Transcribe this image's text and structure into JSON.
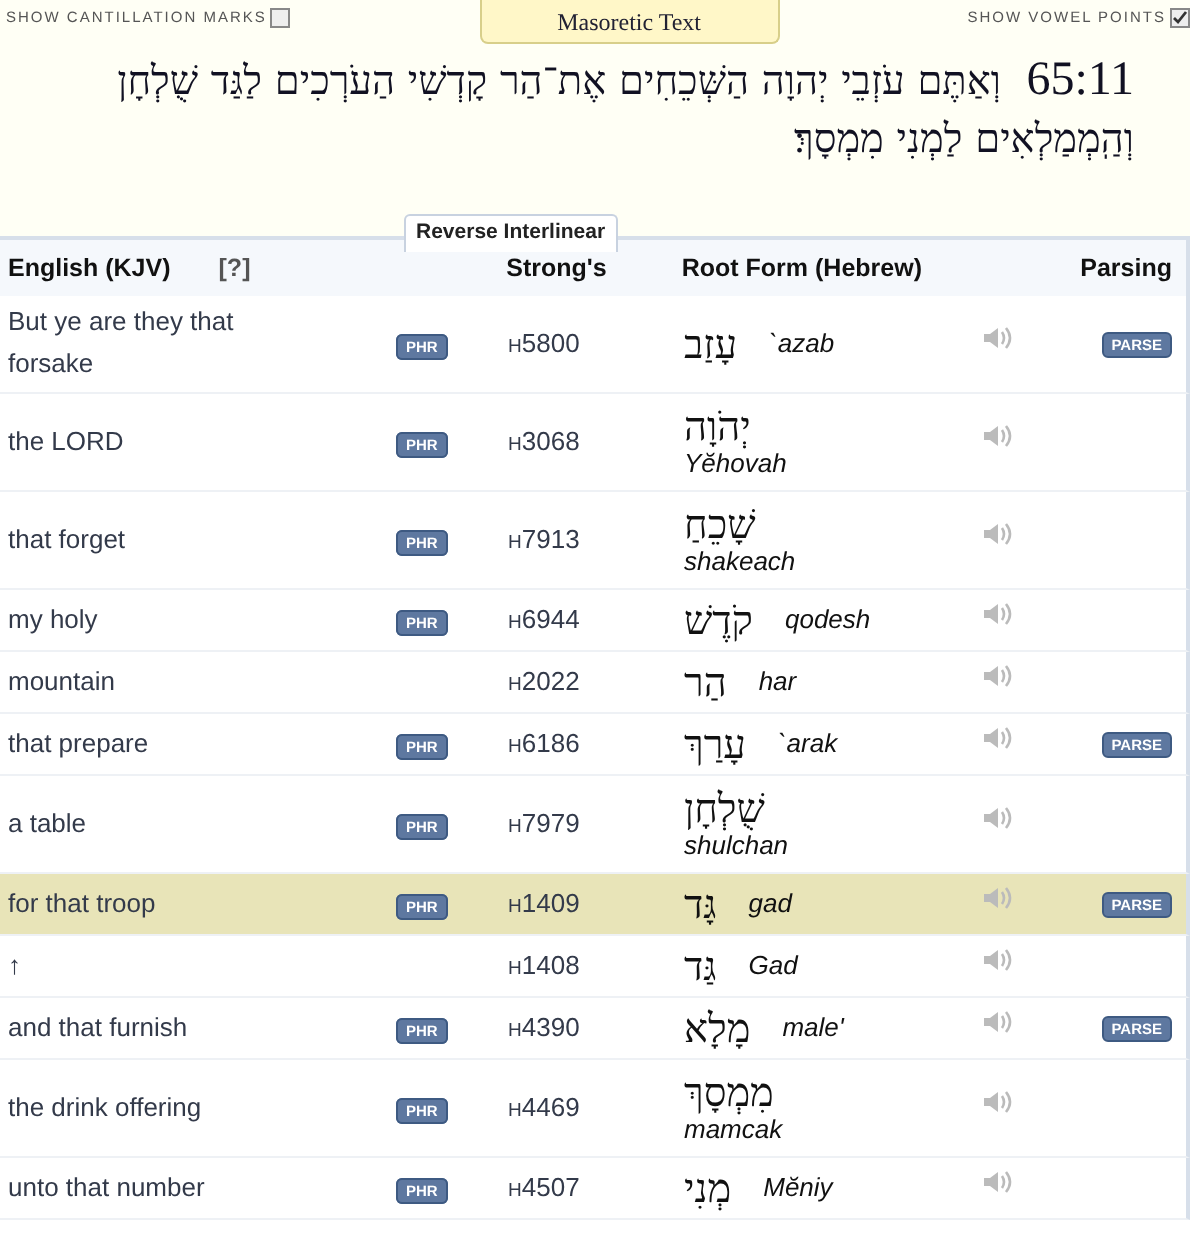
{
  "options": [
    {
      "label": "SHOW CANTILLATION MARKS",
      "checked": false
    },
    {
      "label": "SHOW VOWEL POINTS",
      "checked": true
    }
  ],
  "top_tab": {
    "label": "Masoretic Text"
  },
  "verse": {
    "reference": "65:11",
    "text": "וְאַתֶּם עֹזְבֵי יְהוָה הַשְּׁכֵחִים אֶת־הַר קָדְשִׁי הַעֹרְכִים לַגַּד שֻׁלְחָן וְהַֽמְמַלְאִים לַמְנִי מִמְסָךְ׃"
  },
  "section_tab": {
    "label": "Reverse Interlinear"
  },
  "table": {
    "columns": [
      {
        "label": "English (KJV)",
        "help": "[?]"
      },
      {
        "label": "Strong's"
      },
      {
        "label": "Root Form (Hebrew)"
      },
      {
        "label": "Parsing"
      }
    ],
    "rows": [
      {
        "english": "But ye are they that forsake",
        "phr_label": "PHR",
        "strongs": "H5800",
        "hebrew": "עָזַב",
        "translit": "`azab",
        "kind": "inline",
        "parse_label": "PARSE",
        "selected": false
      },
      {
        "english": "the LORD",
        "phr_label": "PHR",
        "strongs": "H3068",
        "hebrew": "יְהֹוָה",
        "translit": "Yĕhovah",
        "kind": "stacked",
        "selected": false
      },
      {
        "english": "that forget",
        "phr_label": "PHR",
        "strongs": "H7913",
        "hebrew": "שָׁכֵחַ",
        "translit": "shakeach",
        "kind": "stacked",
        "selected": false
      },
      {
        "english": "my holy",
        "phr_label": "PHR",
        "strongs": "H6944",
        "hebrew": "קֹדֶשׁ",
        "translit": "qodesh",
        "kind": "inline",
        "selected": false
      },
      {
        "english": "mountain",
        "strongs": "H2022",
        "hebrew": "הַר",
        "translit": "har",
        "kind": "inline",
        "selected": false
      },
      {
        "english": "that prepare",
        "phr_label": "PHR",
        "strongs": "H6186",
        "hebrew": "עָרַךְ",
        "translit": "`arak",
        "kind": "inline",
        "parse_label": "PARSE",
        "selected": false
      },
      {
        "english": "a table",
        "phr_label": "PHR",
        "strongs": "H7979",
        "hebrew": "שֻׁלְחָן",
        "translit": "shulchan",
        "kind": "stacked",
        "selected": false
      },
      {
        "english": "for that troop",
        "phr_label": "PHR",
        "strongs": "H1409",
        "hebrew": "גָּד",
        "translit": "gad",
        "kind": "inline",
        "parse_label": "PARSE",
        "selected": true
      },
      {
        "english": "↑",
        "strongs": "H1408",
        "hebrew": "גַּד",
        "translit": "Gad",
        "kind": "inline",
        "selected": false
      },
      {
        "english": "and that furnish",
        "phr_label": "PHR",
        "strongs": "H4390",
        "hebrew": "מָלָא",
        "translit": "male'",
        "kind": "inline",
        "parse_label": "PARSE",
        "selected": false
      },
      {
        "english": "the drink offering",
        "phr_label": "PHR",
        "strongs": "H4469",
        "hebrew": "מִמְסָךְ",
        "translit": "mamcak",
        "kind": "stacked",
        "selected": false
      },
      {
        "english": "unto that number",
        "phr_label": "PHR",
        "strongs": "H4507",
        "hebrew": "מְנִי",
        "translit": "Mĕniy",
        "kind": "inline",
        "selected": false
      }
    ]
  }
}
